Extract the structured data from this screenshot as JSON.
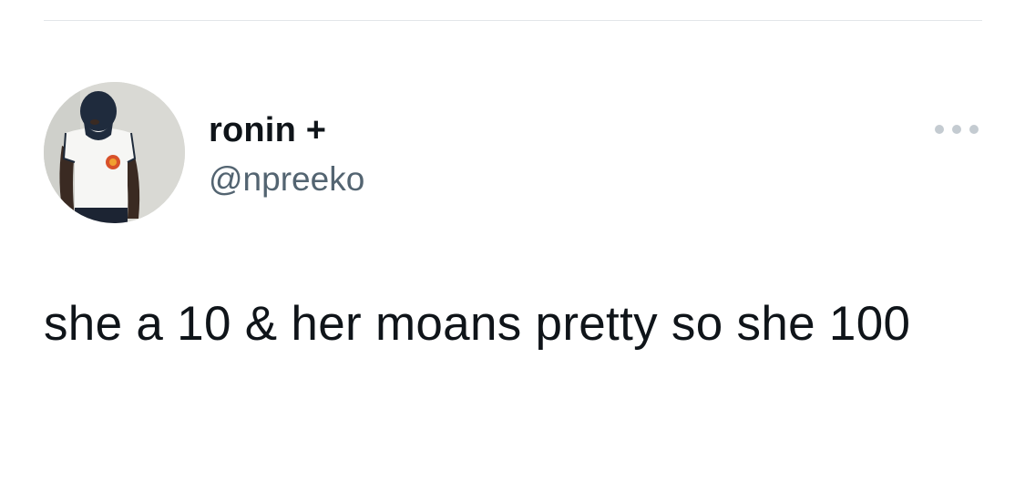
{
  "tweet": {
    "author": {
      "display_name": "ronin +",
      "handle": "@npreeko"
    },
    "more_icon": "more-horizontal-icon",
    "text": "she a 10 & her moans pretty so she 100"
  },
  "colors": {
    "text_primary": "#0f1419",
    "text_secondary": "#536471",
    "divider": "#e3e6e9",
    "more_dots": "#c4cbd1"
  }
}
